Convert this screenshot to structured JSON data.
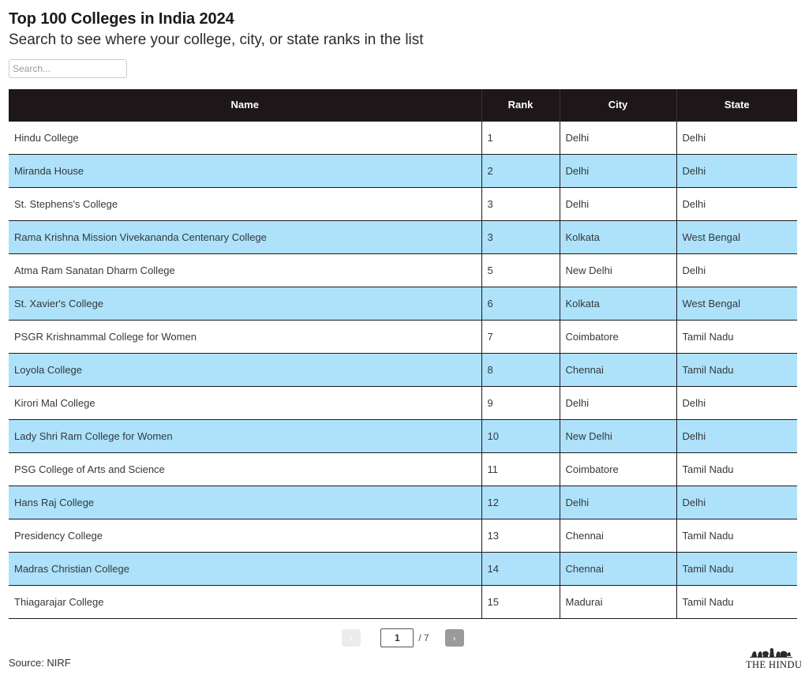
{
  "header": {
    "title": "Top 100 Colleges in India 2024",
    "subtitle": "Search to see where your college, city, or state ranks in the list"
  },
  "search": {
    "placeholder": "Search...",
    "value": ""
  },
  "table": {
    "columns": [
      "Name",
      "Rank",
      "City",
      "State"
    ],
    "rows": [
      {
        "name": "Hindu College",
        "rank": "1",
        "city": "Delhi",
        "state": "Delhi"
      },
      {
        "name": "Miranda House",
        "rank": "2",
        "city": "Delhi",
        "state": "Delhi"
      },
      {
        "name": "St. Stephens's College",
        "rank": "3",
        "city": "Delhi",
        "state": "Delhi"
      },
      {
        "name": "Rama Krishna Mission Vivekananda Centenary College",
        "rank": "3",
        "city": "Kolkata",
        "state": "West Bengal"
      },
      {
        "name": "Atma Ram Sanatan Dharm College",
        "rank": "5",
        "city": "New Delhi",
        "state": "Delhi"
      },
      {
        "name": "St. Xavier's College",
        "rank": "6",
        "city": "Kolkata",
        "state": "West Bengal"
      },
      {
        "name": "PSGR Krishnammal College for Women",
        "rank": "7",
        "city": "Coimbatore",
        "state": "Tamil Nadu"
      },
      {
        "name": "Loyola College",
        "rank": "8",
        "city": "Chennai",
        "state": "Tamil Nadu"
      },
      {
        "name": "Kirori Mal College",
        "rank": "9",
        "city": "Delhi",
        "state": "Delhi"
      },
      {
        "name": "Lady Shri Ram College for Women",
        "rank": "10",
        "city": "New Delhi",
        "state": "Delhi"
      },
      {
        "name": "PSG College of Arts and Science",
        "rank": "11",
        "city": "Coimbatore",
        "state": "Tamil Nadu"
      },
      {
        "name": "Hans Raj College",
        "rank": "12",
        "city": "Delhi",
        "state": "Delhi"
      },
      {
        "name": "Presidency College",
        "rank": "13",
        "city": "Chennai",
        "state": "Tamil Nadu"
      },
      {
        "name": "Madras Christian College",
        "rank": "14",
        "city": "Chennai",
        "state": "Tamil Nadu"
      },
      {
        "name": "Thiagarajar College",
        "rank": "15",
        "city": "Madurai",
        "state": "Tamil Nadu"
      }
    ]
  },
  "pagination": {
    "prev_label": "‹",
    "next_label": "›",
    "current_page": "1",
    "total_pages": "/ 7"
  },
  "footer": {
    "source": "Source: NIRF",
    "logo_text": "THE HINDU"
  },
  "colors": {
    "header_bg": "#1d1719",
    "row_highlight": "#aee2fa",
    "row_default": "#ffffff",
    "next_button": "#9a9a9a",
    "prev_button": "#ececec"
  }
}
